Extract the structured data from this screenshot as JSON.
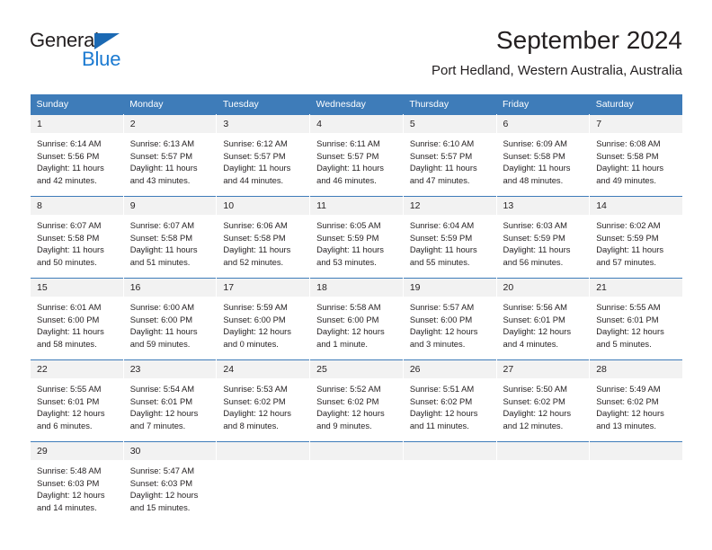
{
  "logo": {
    "word_top": "General",
    "word_bottom": "Blue",
    "triangle_color": "#1b69b3",
    "blue_color": "#1b7ad1"
  },
  "header": {
    "title": "September 2024",
    "subtitle": "Port Hedland, Western Australia, Australia"
  },
  "theme": {
    "header_blue": "#3e7cb9",
    "daynum_gray": "#f2f2f2",
    "text": "#231f20"
  },
  "weekdays": [
    "Sunday",
    "Monday",
    "Tuesday",
    "Wednesday",
    "Thursday",
    "Friday",
    "Saturday"
  ],
  "weeks": [
    [
      {
        "day": "1",
        "sunrise": "Sunrise: 6:14 AM",
        "sunset": "Sunset: 5:56 PM",
        "daylight": "Daylight: 11 hours and 42 minutes."
      },
      {
        "day": "2",
        "sunrise": "Sunrise: 6:13 AM",
        "sunset": "Sunset: 5:57 PM",
        "daylight": "Daylight: 11 hours and 43 minutes."
      },
      {
        "day": "3",
        "sunrise": "Sunrise: 6:12 AM",
        "sunset": "Sunset: 5:57 PM",
        "daylight": "Daylight: 11 hours and 44 minutes."
      },
      {
        "day": "4",
        "sunrise": "Sunrise: 6:11 AM",
        "sunset": "Sunset: 5:57 PM",
        "daylight": "Daylight: 11 hours and 46 minutes."
      },
      {
        "day": "5",
        "sunrise": "Sunrise: 6:10 AM",
        "sunset": "Sunset: 5:57 PM",
        "daylight": "Daylight: 11 hours and 47 minutes."
      },
      {
        "day": "6",
        "sunrise": "Sunrise: 6:09 AM",
        "sunset": "Sunset: 5:58 PM",
        "daylight": "Daylight: 11 hours and 48 minutes."
      },
      {
        "day": "7",
        "sunrise": "Sunrise: 6:08 AM",
        "sunset": "Sunset: 5:58 PM",
        "daylight": "Daylight: 11 hours and 49 minutes."
      }
    ],
    [
      {
        "day": "8",
        "sunrise": "Sunrise: 6:07 AM",
        "sunset": "Sunset: 5:58 PM",
        "daylight": "Daylight: 11 hours and 50 minutes."
      },
      {
        "day": "9",
        "sunrise": "Sunrise: 6:07 AM",
        "sunset": "Sunset: 5:58 PM",
        "daylight": "Daylight: 11 hours and 51 minutes."
      },
      {
        "day": "10",
        "sunrise": "Sunrise: 6:06 AM",
        "sunset": "Sunset: 5:58 PM",
        "daylight": "Daylight: 11 hours and 52 minutes."
      },
      {
        "day": "11",
        "sunrise": "Sunrise: 6:05 AM",
        "sunset": "Sunset: 5:59 PM",
        "daylight": "Daylight: 11 hours and 53 minutes."
      },
      {
        "day": "12",
        "sunrise": "Sunrise: 6:04 AM",
        "sunset": "Sunset: 5:59 PM",
        "daylight": "Daylight: 11 hours and 55 minutes."
      },
      {
        "day": "13",
        "sunrise": "Sunrise: 6:03 AM",
        "sunset": "Sunset: 5:59 PM",
        "daylight": "Daylight: 11 hours and 56 minutes."
      },
      {
        "day": "14",
        "sunrise": "Sunrise: 6:02 AM",
        "sunset": "Sunset: 5:59 PM",
        "daylight": "Daylight: 11 hours and 57 minutes."
      }
    ],
    [
      {
        "day": "15",
        "sunrise": "Sunrise: 6:01 AM",
        "sunset": "Sunset: 6:00 PM",
        "daylight": "Daylight: 11 hours and 58 minutes."
      },
      {
        "day": "16",
        "sunrise": "Sunrise: 6:00 AM",
        "sunset": "Sunset: 6:00 PM",
        "daylight": "Daylight: 11 hours and 59 minutes."
      },
      {
        "day": "17",
        "sunrise": "Sunrise: 5:59 AM",
        "sunset": "Sunset: 6:00 PM",
        "daylight": "Daylight: 12 hours and 0 minutes."
      },
      {
        "day": "18",
        "sunrise": "Sunrise: 5:58 AM",
        "sunset": "Sunset: 6:00 PM",
        "daylight": "Daylight: 12 hours and 1 minute."
      },
      {
        "day": "19",
        "sunrise": "Sunrise: 5:57 AM",
        "sunset": "Sunset: 6:00 PM",
        "daylight": "Daylight: 12 hours and 3 minutes."
      },
      {
        "day": "20",
        "sunrise": "Sunrise: 5:56 AM",
        "sunset": "Sunset: 6:01 PM",
        "daylight": "Daylight: 12 hours and 4 minutes."
      },
      {
        "day": "21",
        "sunrise": "Sunrise: 5:55 AM",
        "sunset": "Sunset: 6:01 PM",
        "daylight": "Daylight: 12 hours and 5 minutes."
      }
    ],
    [
      {
        "day": "22",
        "sunrise": "Sunrise: 5:55 AM",
        "sunset": "Sunset: 6:01 PM",
        "daylight": "Daylight: 12 hours and 6 minutes."
      },
      {
        "day": "23",
        "sunrise": "Sunrise: 5:54 AM",
        "sunset": "Sunset: 6:01 PM",
        "daylight": "Daylight: 12 hours and 7 minutes."
      },
      {
        "day": "24",
        "sunrise": "Sunrise: 5:53 AM",
        "sunset": "Sunset: 6:02 PM",
        "daylight": "Daylight: 12 hours and 8 minutes."
      },
      {
        "day": "25",
        "sunrise": "Sunrise: 5:52 AM",
        "sunset": "Sunset: 6:02 PM",
        "daylight": "Daylight: 12 hours and 9 minutes."
      },
      {
        "day": "26",
        "sunrise": "Sunrise: 5:51 AM",
        "sunset": "Sunset: 6:02 PM",
        "daylight": "Daylight: 12 hours and 11 minutes."
      },
      {
        "day": "27",
        "sunrise": "Sunrise: 5:50 AM",
        "sunset": "Sunset: 6:02 PM",
        "daylight": "Daylight: 12 hours and 12 minutes."
      },
      {
        "day": "28",
        "sunrise": "Sunrise: 5:49 AM",
        "sunset": "Sunset: 6:02 PM",
        "daylight": "Daylight: 12 hours and 13 minutes."
      }
    ],
    [
      {
        "day": "29",
        "sunrise": "Sunrise: 5:48 AM",
        "sunset": "Sunset: 6:03 PM",
        "daylight": "Daylight: 12 hours and 14 minutes."
      },
      {
        "day": "30",
        "sunrise": "Sunrise: 5:47 AM",
        "sunset": "Sunset: 6:03 PM",
        "daylight": "Daylight: 12 hours and 15 minutes."
      },
      {
        "day": "",
        "sunrise": "",
        "sunset": "",
        "daylight": ""
      },
      {
        "day": "",
        "sunrise": "",
        "sunset": "",
        "daylight": ""
      },
      {
        "day": "",
        "sunrise": "",
        "sunset": "",
        "daylight": ""
      },
      {
        "day": "",
        "sunrise": "",
        "sunset": "",
        "daylight": ""
      },
      {
        "day": "",
        "sunrise": "",
        "sunset": "",
        "daylight": ""
      }
    ]
  ]
}
